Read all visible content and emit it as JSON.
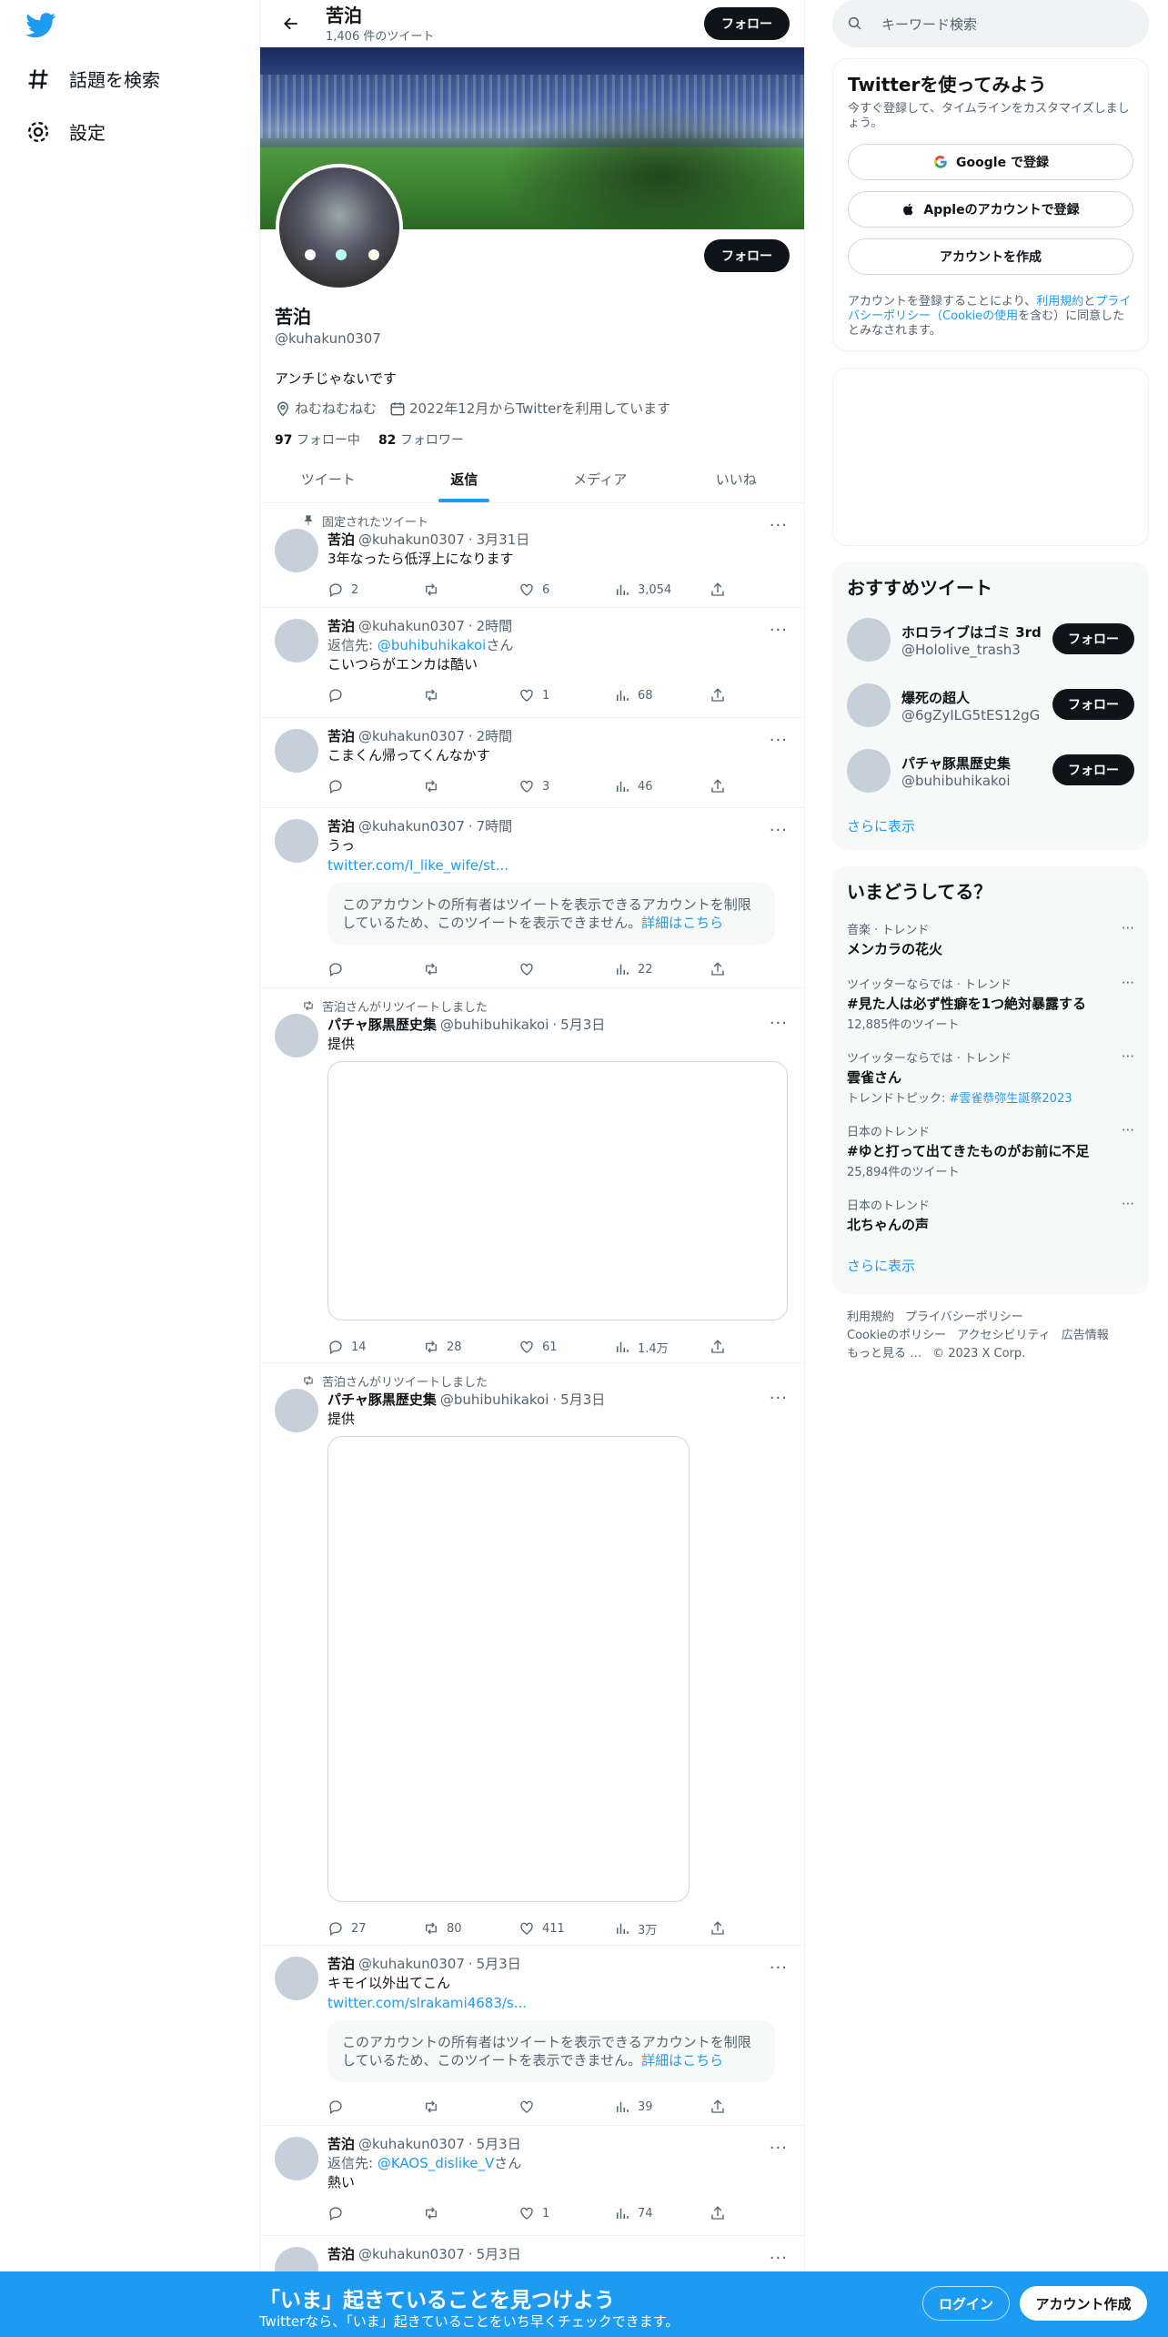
{
  "sidebar": {
    "items": [
      {
        "label": "話題を検索",
        "icon": "hashtag-icon"
      },
      {
        "label": "設定",
        "icon": "gear-icon"
      }
    ]
  },
  "header": {
    "name": "苦泊",
    "tweet_count": "1,406 件のツイート",
    "follow_label": "フォロー"
  },
  "profile": {
    "name": "苦泊",
    "handle": "@kuhakun0307",
    "bio": "アンチじゃないです",
    "location": "ねむねむねむ",
    "joined": "2022年12月からTwitterを利用しています",
    "following_count": "97",
    "following_label": "フォロー中",
    "followers_count": "82",
    "followers_label": "フォロワー",
    "follow_label": "フォロー"
  },
  "tabs": [
    {
      "label": "ツイート",
      "active": false
    },
    {
      "label": "返信",
      "active": true
    },
    {
      "label": "メディア",
      "active": false
    },
    {
      "label": "いいね",
      "active": false
    }
  ],
  "tweets": [
    {
      "context": "固定されたツイート",
      "name": "苦泊",
      "handle": "@kuhakun0307",
      "time": "3月31日",
      "text": "3年なったら低浮上になります",
      "replies": "2",
      "retweets": "",
      "likes": "6",
      "views": "3,054"
    },
    {
      "name": "苦泊",
      "handle": "@kuhakun0307",
      "time": "2時間",
      "reply_prefix": "返信先: ",
      "reply_to": "@buhibuhikakoi",
      "reply_suffix": "さん",
      "text": "こいつらがエンカは酷い",
      "replies": "",
      "retweets": "",
      "likes": "1",
      "views": "68"
    },
    {
      "name": "苦泊",
      "handle": "@kuhakun0307",
      "time": "2時間",
      "text": "こまくん帰ってくんなかす",
      "replies": "",
      "retweets": "",
      "likes": "3",
      "views": "46"
    },
    {
      "name": "苦泊",
      "handle": "@kuhakun0307",
      "time": "7時間",
      "text": "うっ",
      "link": "twitter.com/I_like_wife/st...",
      "notice": "このアカウントの所有者はツイートを表示できるアカウントを制限しているため、このツイートを表示できません。",
      "notice_link": "詳細はこちら",
      "replies": "",
      "retweets": "",
      "likes": "",
      "views": "22"
    },
    {
      "context": "苦泊さんがリツイートしました",
      "name": "パチャ豚黒歴史集",
      "handle": "@buhibuhikakoi",
      "time": "5月3日",
      "text": "提供",
      "replies": "14",
      "retweets": "28",
      "likes": "61",
      "views": "1.4万"
    },
    {
      "context": "苦泊さんがリツイートしました",
      "name": "パチャ豚黒歴史集",
      "handle": "@buhibuhikakoi",
      "time": "5月3日",
      "text": "提供",
      "replies": "27",
      "retweets": "80",
      "likes": "411",
      "views": "3万"
    },
    {
      "name": "苦泊",
      "handle": "@kuhakun0307",
      "time": "5月3日",
      "text": "キモイ以外出てこん",
      "link": "twitter.com/slrakami4683/s...",
      "notice": "このアカウントの所有者はツイートを表示できるアカウントを制限しているため、このツイートを表示できません。",
      "notice_link": "詳細はこちら",
      "replies": "",
      "retweets": "",
      "likes": "",
      "views": "39"
    },
    {
      "name": "苦泊",
      "handle": "@kuhakun0307",
      "time": "5月3日",
      "reply_prefix": "返信先: ",
      "reply_to": "@KAOS_dislike_V",
      "reply_suffix": "さん",
      "text": "熱い",
      "replies": "",
      "retweets": "",
      "likes": "1",
      "views": "74"
    },
    {
      "name": "苦泊",
      "handle": "@kuhakun0307",
      "time": "5月3日"
    }
  ],
  "right": {
    "search_placeholder": "キーワード検索",
    "signup": {
      "title": "Twitterを使ってみよう",
      "subtitle": "今すぐ登録して、タイムラインをカスタマイズしましょう。",
      "google": "Google で登録",
      "apple": "Appleのアカウントで登録",
      "create": "アカウントを作成",
      "legal_1": "アカウントを登録することにより、",
      "legal_terms": "利用規約",
      "legal_2": "と",
      "legal_privacy": "プライバシーポリシー（Cookieの使用",
      "legal_3": "を含む）に同意したとみなされます。"
    },
    "recommend": {
      "title": "おすすめツイート",
      "users": [
        {
          "name": "ホロライブはゴミ 3rd",
          "handle": "@Hololive_trash3"
        },
        {
          "name": "爆死の超人",
          "handle": "@6gZyILG5tES12gG"
        },
        {
          "name": "パチャ豚黒歴史集",
          "handle": "@buhibuhikakoi"
        }
      ],
      "follow_label": "フォロー",
      "more": "さらに表示"
    },
    "trends": {
      "title": "いまどうしてる？",
      "items": [
        {
          "cat": "音楽 · トレンド",
          "title": "メンカラの花火",
          "count": ""
        },
        {
          "cat": "ツイッターならでは · トレンド",
          "title": "#見た人は必ず性癖を1つ絶対暴露する",
          "count": "12,885件のツイート"
        },
        {
          "cat": "ツイッターならでは · トレンド",
          "title": "雲雀さん",
          "count": "トレンドトピック: ",
          "count_link": "#雲雀恭弥生誕祭2023"
        },
        {
          "cat": "日本のトレンド",
          "title": "#ゆと打って出てきたものがお前に不足",
          "count": "25,894件のツイート"
        },
        {
          "cat": "日本のトレンド",
          "title": "北ちゃんの声",
          "count": ""
        }
      ],
      "more": "さらに表示"
    },
    "footer": [
      "利用規約",
      "プライバシーポリシー",
      "Cookieのポリシー",
      "アクセシビリティ",
      "広告情報",
      "もっと見る …",
      "© 2023 X Corp."
    ]
  },
  "bottom": {
    "title": "「いま」起きていることを見つけよう",
    "subtitle": "Twitterなら、「いま」起きていることをいち早くチェックできます。",
    "login": "ログイン",
    "signup": "アカウント作成"
  },
  "colors": {
    "accent": "#1d9bf0",
    "dark": "#0f1419",
    "muted": "#536471"
  }
}
